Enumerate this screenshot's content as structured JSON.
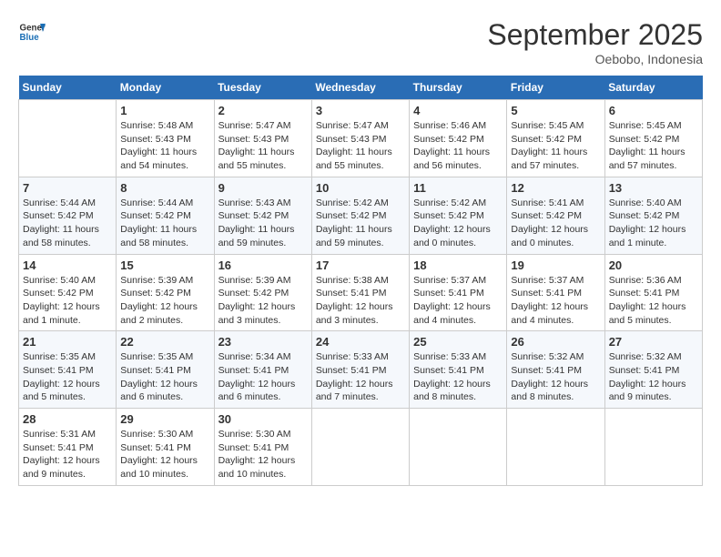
{
  "header": {
    "logo_line1": "General",
    "logo_line2": "Blue",
    "month": "September 2025",
    "location": "Oebobo, Indonesia"
  },
  "days_of_week": [
    "Sunday",
    "Monday",
    "Tuesday",
    "Wednesday",
    "Thursday",
    "Friday",
    "Saturday"
  ],
  "weeks": [
    [
      {
        "day": "",
        "info": ""
      },
      {
        "day": "1",
        "info": "Sunrise: 5:48 AM\nSunset: 5:43 PM\nDaylight: 11 hours\nand 54 minutes."
      },
      {
        "day": "2",
        "info": "Sunrise: 5:47 AM\nSunset: 5:43 PM\nDaylight: 11 hours\nand 55 minutes."
      },
      {
        "day": "3",
        "info": "Sunrise: 5:47 AM\nSunset: 5:43 PM\nDaylight: 11 hours\nand 55 minutes."
      },
      {
        "day": "4",
        "info": "Sunrise: 5:46 AM\nSunset: 5:42 PM\nDaylight: 11 hours\nand 56 minutes."
      },
      {
        "day": "5",
        "info": "Sunrise: 5:45 AM\nSunset: 5:42 PM\nDaylight: 11 hours\nand 57 minutes."
      },
      {
        "day": "6",
        "info": "Sunrise: 5:45 AM\nSunset: 5:42 PM\nDaylight: 11 hours\nand 57 minutes."
      }
    ],
    [
      {
        "day": "7",
        "info": "Sunrise: 5:44 AM\nSunset: 5:42 PM\nDaylight: 11 hours\nand 58 minutes."
      },
      {
        "day": "8",
        "info": "Sunrise: 5:44 AM\nSunset: 5:42 PM\nDaylight: 11 hours\nand 58 minutes."
      },
      {
        "day": "9",
        "info": "Sunrise: 5:43 AM\nSunset: 5:42 PM\nDaylight: 11 hours\nand 59 minutes."
      },
      {
        "day": "10",
        "info": "Sunrise: 5:42 AM\nSunset: 5:42 PM\nDaylight: 11 hours\nand 59 minutes."
      },
      {
        "day": "11",
        "info": "Sunrise: 5:42 AM\nSunset: 5:42 PM\nDaylight: 12 hours\nand 0 minutes."
      },
      {
        "day": "12",
        "info": "Sunrise: 5:41 AM\nSunset: 5:42 PM\nDaylight: 12 hours\nand 0 minutes."
      },
      {
        "day": "13",
        "info": "Sunrise: 5:40 AM\nSunset: 5:42 PM\nDaylight: 12 hours\nand 1 minute."
      }
    ],
    [
      {
        "day": "14",
        "info": "Sunrise: 5:40 AM\nSunset: 5:42 PM\nDaylight: 12 hours\nand 1 minute."
      },
      {
        "day": "15",
        "info": "Sunrise: 5:39 AM\nSunset: 5:42 PM\nDaylight: 12 hours\nand 2 minutes."
      },
      {
        "day": "16",
        "info": "Sunrise: 5:39 AM\nSunset: 5:42 PM\nDaylight: 12 hours\nand 3 minutes."
      },
      {
        "day": "17",
        "info": "Sunrise: 5:38 AM\nSunset: 5:41 PM\nDaylight: 12 hours\nand 3 minutes."
      },
      {
        "day": "18",
        "info": "Sunrise: 5:37 AM\nSunset: 5:41 PM\nDaylight: 12 hours\nand 4 minutes."
      },
      {
        "day": "19",
        "info": "Sunrise: 5:37 AM\nSunset: 5:41 PM\nDaylight: 12 hours\nand 4 minutes."
      },
      {
        "day": "20",
        "info": "Sunrise: 5:36 AM\nSunset: 5:41 PM\nDaylight: 12 hours\nand 5 minutes."
      }
    ],
    [
      {
        "day": "21",
        "info": "Sunrise: 5:35 AM\nSunset: 5:41 PM\nDaylight: 12 hours\nand 5 minutes."
      },
      {
        "day": "22",
        "info": "Sunrise: 5:35 AM\nSunset: 5:41 PM\nDaylight: 12 hours\nand 6 minutes."
      },
      {
        "day": "23",
        "info": "Sunrise: 5:34 AM\nSunset: 5:41 PM\nDaylight: 12 hours\nand 6 minutes."
      },
      {
        "day": "24",
        "info": "Sunrise: 5:33 AM\nSunset: 5:41 PM\nDaylight: 12 hours\nand 7 minutes."
      },
      {
        "day": "25",
        "info": "Sunrise: 5:33 AM\nSunset: 5:41 PM\nDaylight: 12 hours\nand 8 minutes."
      },
      {
        "day": "26",
        "info": "Sunrise: 5:32 AM\nSunset: 5:41 PM\nDaylight: 12 hours\nand 8 minutes."
      },
      {
        "day": "27",
        "info": "Sunrise: 5:32 AM\nSunset: 5:41 PM\nDaylight: 12 hours\nand 9 minutes."
      }
    ],
    [
      {
        "day": "28",
        "info": "Sunrise: 5:31 AM\nSunset: 5:41 PM\nDaylight: 12 hours\nand 9 minutes."
      },
      {
        "day": "29",
        "info": "Sunrise: 5:30 AM\nSunset: 5:41 PM\nDaylight: 12 hours\nand 10 minutes."
      },
      {
        "day": "30",
        "info": "Sunrise: 5:30 AM\nSunset: 5:41 PM\nDaylight: 12 hours\nand 10 minutes."
      },
      {
        "day": "",
        "info": ""
      },
      {
        "day": "",
        "info": ""
      },
      {
        "day": "",
        "info": ""
      },
      {
        "day": "",
        "info": ""
      }
    ]
  ]
}
